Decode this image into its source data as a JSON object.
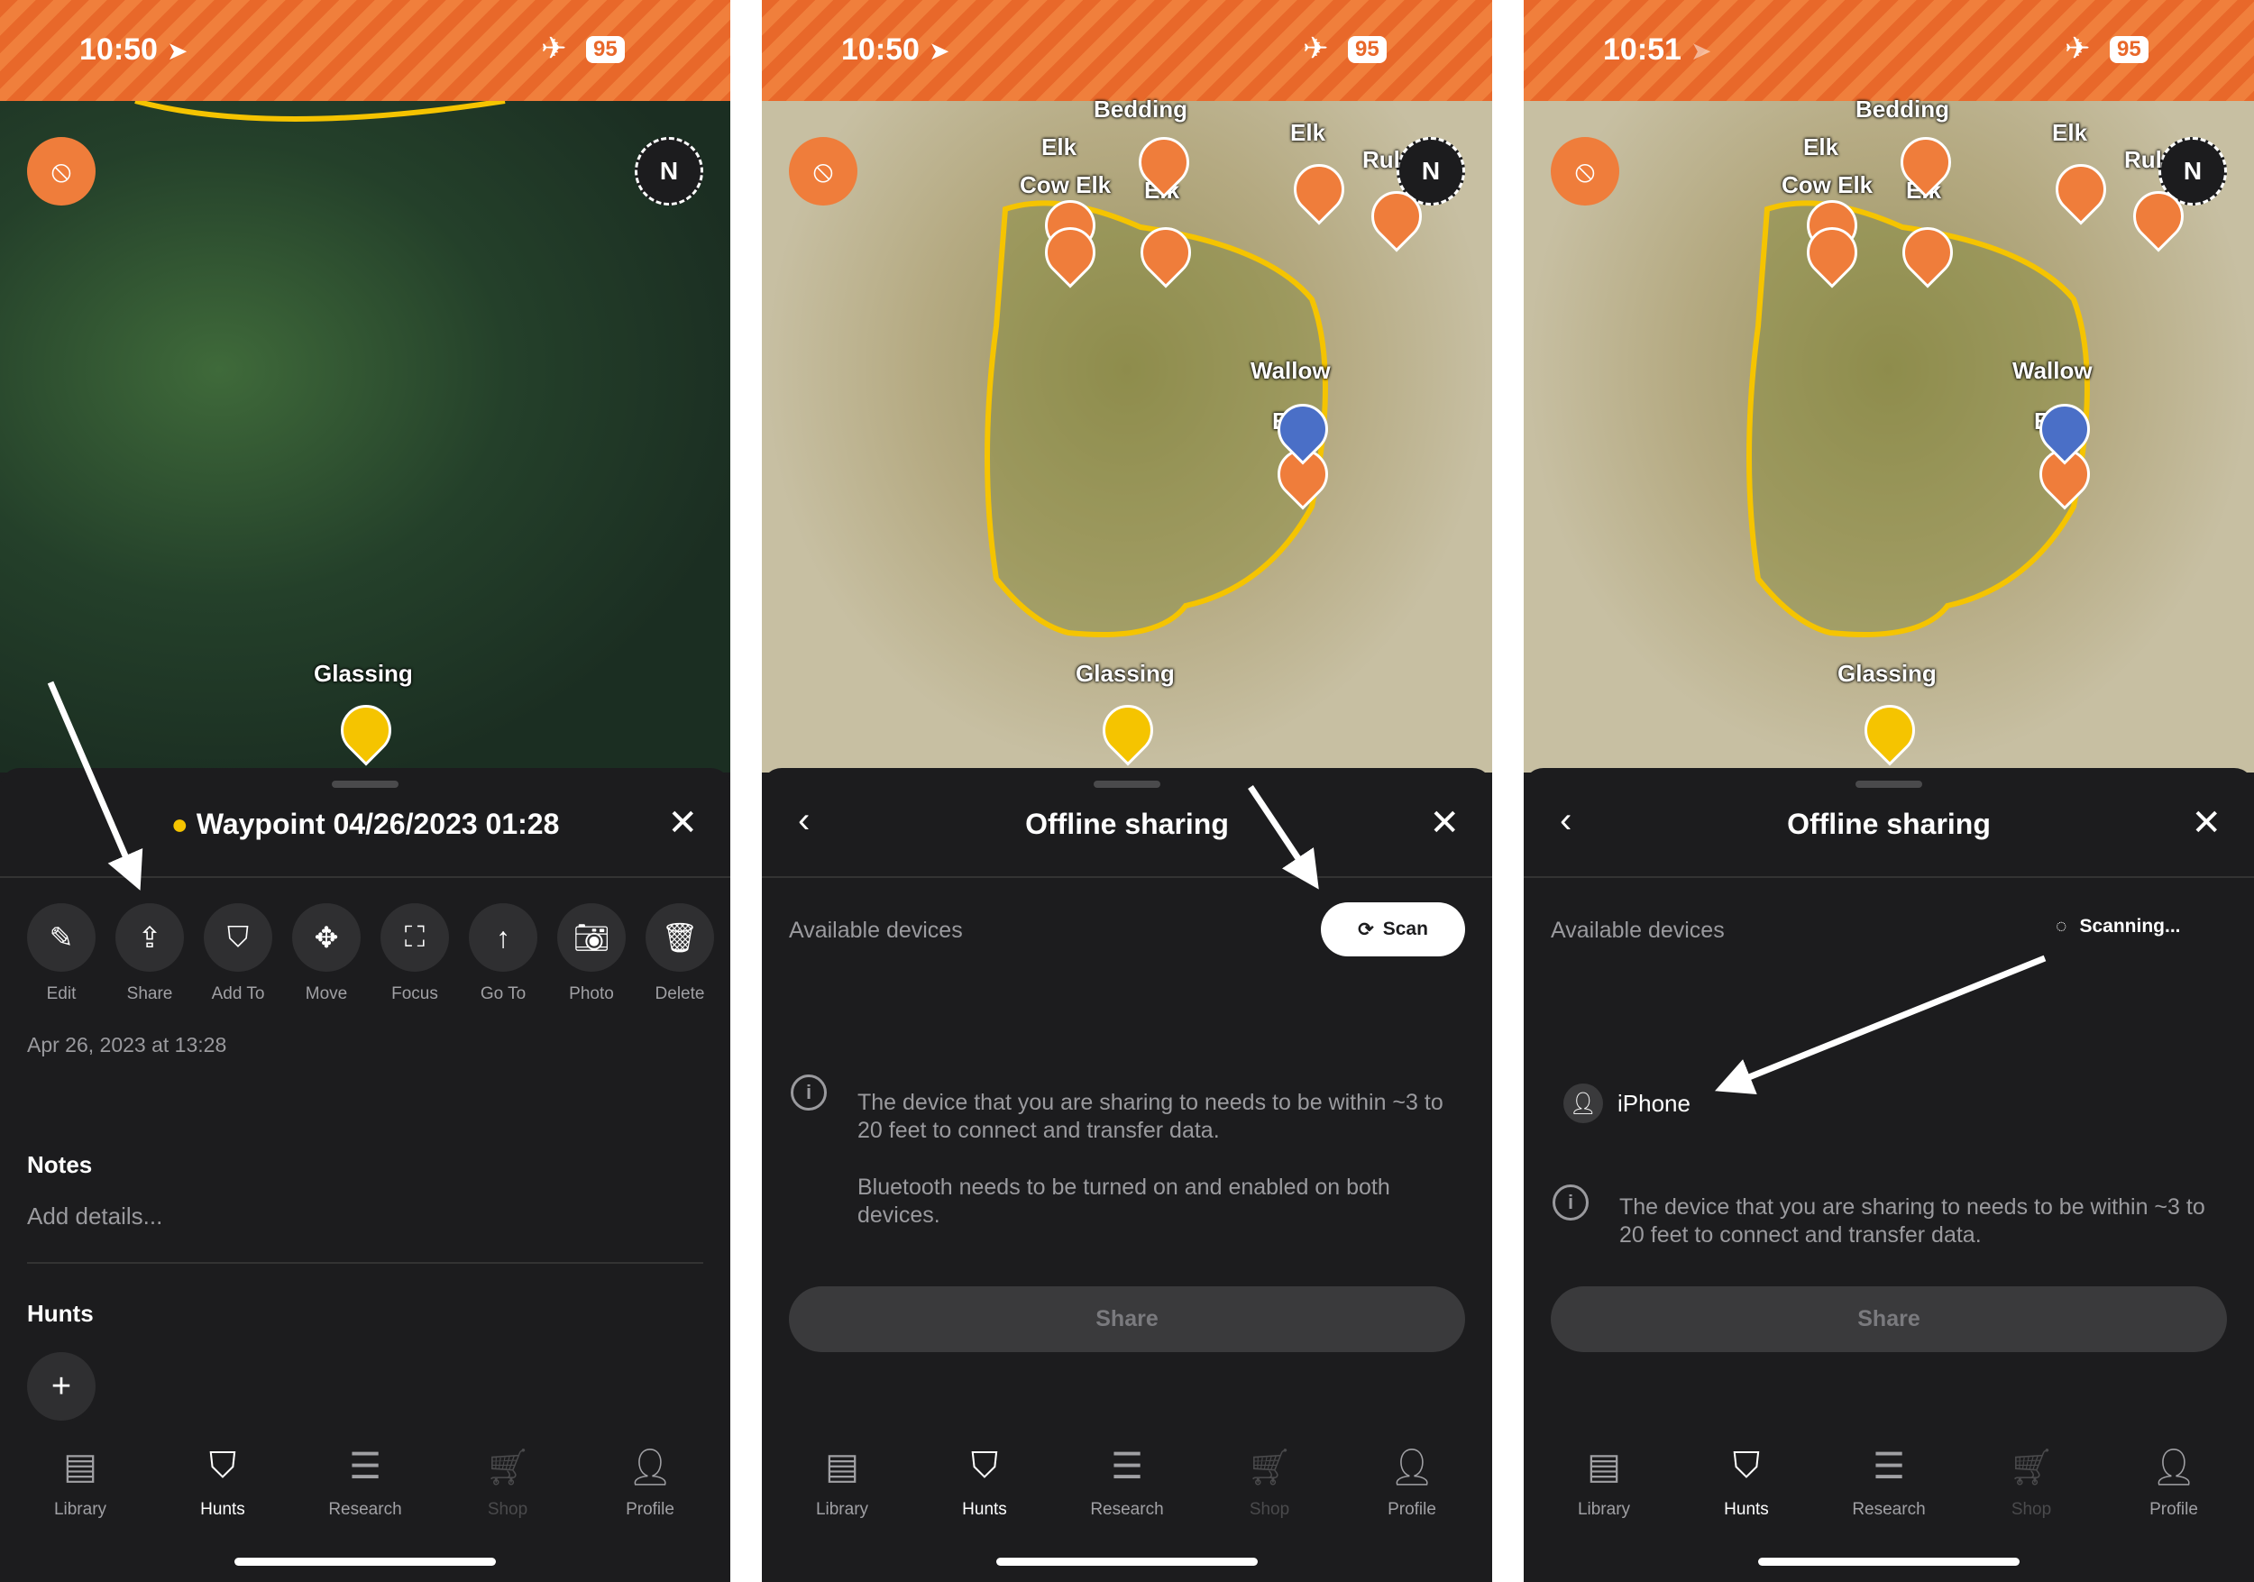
{
  "colors": {
    "accent": "#ef7d3b",
    "glassing_pin": "#f5c400",
    "sheet_bg": "#1c1c1e"
  },
  "screens": [
    {
      "status": {
        "time": "10:50",
        "battery": "95"
      },
      "map": {
        "labels": [
          "Glassing"
        ]
      },
      "sheet": {
        "title": "Waypoint 04/26/2023 01:28",
        "actions": [
          {
            "label": "Edit",
            "icon": "pencil-icon"
          },
          {
            "label": "Share",
            "icon": "share-icon"
          },
          {
            "label": "Add To",
            "icon": "shield-star-icon"
          },
          {
            "label": "Move",
            "icon": "move-icon"
          },
          {
            "label": "Focus",
            "icon": "focus-icon"
          },
          {
            "label": "Go To",
            "icon": "arrow-up-icon"
          },
          {
            "label": "Photo",
            "icon": "camera-icon"
          },
          {
            "label": "Delete",
            "icon": "trash-icon"
          }
        ],
        "date": "Apr 26, 2023 at 13:28",
        "notes_heading": "Notes",
        "notes_placeholder": "Add details...",
        "hunts_heading": "Hunts"
      }
    },
    {
      "status": {
        "time": "10:50",
        "battery": "95"
      },
      "map": {
        "labels": [
          "Bedding",
          "Elk",
          "Cow Elk",
          "Elk",
          "Elk",
          "Rul",
          "Wallow",
          "Elk",
          "Glassing"
        ]
      },
      "sheet": {
        "title": "Offline sharing",
        "available": "Available devices",
        "scan_label": "Scan",
        "info1": "The device that you are sharing to needs to be within ~3 to 20 feet to connect and transfer data.",
        "info2": "Bluetooth needs to be turned on and enabled on both devices.",
        "share_label": "Share"
      }
    },
    {
      "status": {
        "time": "10:51",
        "battery": "95"
      },
      "map": {
        "labels": [
          "Bedding",
          "Elk",
          "Cow Elk",
          "Elk",
          "Elk",
          "Rul",
          "Wallow",
          "Elk",
          "Glassing"
        ]
      },
      "sheet": {
        "title": "Offline sharing",
        "available": "Available devices",
        "scanning_label": "Scanning...",
        "device": "iPhone",
        "info1": "The device that you are sharing to needs to be within ~3 to 20 feet to connect and transfer data.",
        "share_label": "Share"
      }
    }
  ],
  "nav": [
    {
      "label": "Library",
      "icon": "library-icon"
    },
    {
      "label": "Hunts",
      "icon": "hunts-icon",
      "active": true
    },
    {
      "label": "Research",
      "icon": "research-icon"
    },
    {
      "label": "Shop",
      "icon": "shop-icon",
      "disabled": true
    },
    {
      "label": "Profile",
      "icon": "profile-icon"
    }
  ],
  "compass_label": "N"
}
